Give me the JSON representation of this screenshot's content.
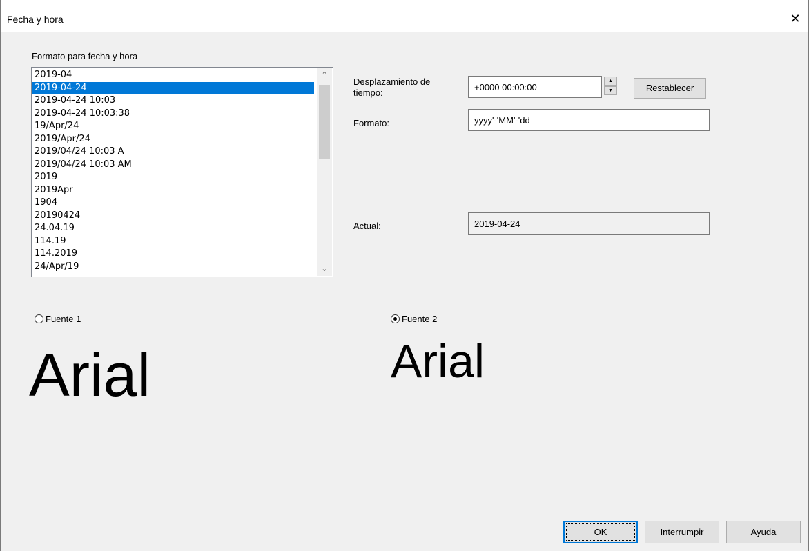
{
  "window": {
    "title": "Fecha y hora",
    "close_glyph": "✕"
  },
  "format_list": {
    "label": "Formato para fecha y hora",
    "items": [
      "2019-04",
      "2019-04-24",
      "2019-04-24 10:03",
      "2019-04-24 10:03:38",
      "19/Apr/24",
      "2019/Apr/24",
      "2019/04/24 10:03 A",
      "2019/04/24 10:03 AM",
      "2019",
      "2019Apr",
      "1904",
      "20190424",
      "24.04.19",
      "114.19",
      "114.2019",
      "24/Apr/19"
    ],
    "selected_index": 1,
    "scroll_up_glyph": "⌃",
    "scroll_down_glyph": "⌄"
  },
  "offset": {
    "label_line1": "Desplazamiento de",
    "label_line2": "tiempo:",
    "value": "+0000 00:00:00",
    "spin_up": "▲",
    "spin_down": "▼",
    "reset_label": "Restablecer"
  },
  "format": {
    "label": "Formato:",
    "value": "yyyy'-'MM'-'dd"
  },
  "current": {
    "label": "Actual:",
    "value": "2019-04-24"
  },
  "fonts": {
    "font1": {
      "label": "Fuente 1",
      "checked": false,
      "preview": "Arial"
    },
    "font2": {
      "label": "Fuente 2",
      "checked": true,
      "preview": "Arial"
    }
  },
  "buttons": {
    "ok": "OK",
    "cancel": "Interrumpir",
    "help": "Ayuda"
  },
  "colors": {
    "selection": "#0078d7",
    "dialog_bg": "#f0f0f0"
  }
}
